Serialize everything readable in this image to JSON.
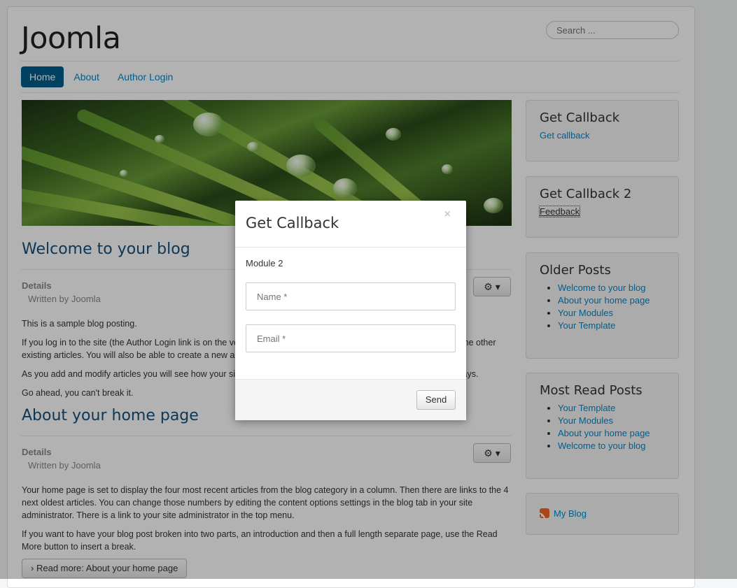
{
  "header": {
    "brand": "Joomla",
    "search_placeholder": "Search ..."
  },
  "nav": {
    "items": [
      {
        "label": "Home",
        "active": true
      },
      {
        "label": "About"
      },
      {
        "label": "Author Login"
      }
    ]
  },
  "articles": [
    {
      "title": "Welcome to your blog",
      "details_label": "Details",
      "author": "Written by Joomla",
      "paragraphs": [
        "This is a sample blog posting.",
        "If you log in to the site (the Author Login link is on the very bottom of this page) you will be able to edit it and all of the other existing articles. You will also be able to create a new article and make other changes to the site.",
        "As you add and modify articles you will see how your site changes and also how you can customise it in various ways.",
        "Go ahead, you can't break it."
      ]
    },
    {
      "title": "About your home page",
      "details_label": "Details",
      "author": "Written by Joomla",
      "paragraphs": [
        "Your home page is set to display the four most recent articles from the blog category in a column. Then there are links to the 4 next oldest articles. You can change those numbers by editing the content options settings in the blog tab in your site administrator. There is a link to your site administrator in the top menu.",
        "If you want to have your blog post broken into two parts, an introduction and then a full length separate page, use the Read More button to insert a break."
      ],
      "read_more": "Read more: About your home page"
    }
  ],
  "sidebar": {
    "get_callback": {
      "title": "Get Callback",
      "link": "Get callback"
    },
    "get_callback_2": {
      "title": "Get Callback 2",
      "link": "Feedback"
    },
    "older_posts": {
      "title": "Older Posts",
      "items": [
        "Welcome to your blog",
        "About your home page",
        "Your Modules",
        "Your Template"
      ]
    },
    "most_read": {
      "title": "Most Read Posts",
      "items": [
        "Your Template",
        "Your Modules",
        "About your home page",
        "Welcome to your blog"
      ]
    },
    "feed": {
      "label": "My Blog"
    }
  },
  "modal": {
    "title": "Get Callback",
    "close": "×",
    "module_label": "Module 2",
    "name_placeholder": "Name *",
    "email_placeholder": "Email *",
    "send": "Send"
  }
}
